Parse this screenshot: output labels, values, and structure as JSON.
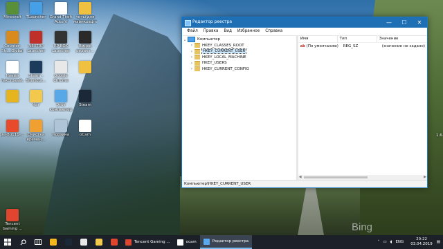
{
  "desktop": {
    "icons_col1": [
      {
        "label": "Minecraft",
        "color": "#5a8f3a"
      },
      {
        "label": "Counter-Str... Global Offe...",
        "color": "#d88a1c"
      },
      {
        "label": "Новый текстовый...",
        "color": "#ffffff"
      },
      {
        "label": "",
        "color": "#e6b41e"
      },
      {
        "label": "jre-8u111-...",
        "color": "#e84b2c"
      },
      {
        "label": "Tencent Gaming ...",
        "color": "#e0462f"
      }
    ],
    "icons_col2": [
      {
        "label": "TLauncher",
        "color": "#46a0e8"
      },
      {
        "label": "NEXTRP Launcher",
        "color": "#c0302a"
      },
      {
        "label": "Steam - Shortcut...",
        "color": "#1d3b5a"
      },
      {
        "label": "Чат",
        "color": "#f2c94c"
      },
      {
        "label": "Очистка времен...",
        "color": "#f0a030"
      }
    ],
    "icons_col3": [
      {
        "label": "Grand Theft Auto V",
        "color": "#ffffff"
      },
      {
        "label": "RP BOX Launcher",
        "color": "#333333"
      },
      {
        "label": "Google Chrome",
        "color": "#e8e8e8"
      },
      {
        "label": "Этот компьютер",
        "color": "#58a8e8"
      },
      {
        "label": "Корзина",
        "color": "#b0c4d8"
      }
    ],
    "icons_col4": [
      {
        "label": "читы для майнкрафта",
        "color": "#f0c040"
      },
      {
        "label": "Видео редакт...",
        "color": "#2a2a2a"
      },
      {
        "label": "",
        "color": "#f0c040"
      },
      {
        "label": "Steam",
        "color": "#1b2838"
      },
      {
        "label": "oCam",
        "color": "#ffffff"
      }
    ],
    "edge_fragment": "1.6.8",
    "bing_logo": "Bing"
  },
  "window": {
    "title": "Редактор реестра",
    "controls": {
      "minimize": "—",
      "maximize": "☐",
      "close": "✕"
    },
    "menu": [
      "Файл",
      "Правка",
      "Вид",
      "Избранное",
      "Справка"
    ],
    "tree": {
      "root": "Компьютер",
      "keys": [
        "HKEY_CLASSES_ROOT",
        "HKEY_CURRENT_USER",
        "HKEY_LOCAL_MACHINE",
        "HKEY_USERS",
        "HKEY_CURRENT_CONFIG"
      ],
      "selected_index": 1
    },
    "values": {
      "columns": [
        "Имя",
        "Тип",
        "Значение"
      ],
      "rows": [
        {
          "name": "(По умолчанию)",
          "type": "REG_SZ",
          "value": "(значение не задано)"
        }
      ],
      "row_icon": "ab"
    },
    "status_path": "Компьютер\\HKEY_CURRENT_USER"
  },
  "taskbar": {
    "apps": [
      {
        "label": "Tencent Gaming ...",
        "color": "#e0462f",
        "active": false
      },
      {
        "label": "ocam",
        "color": "#ffffff",
        "active": false
      },
      {
        "label": "Редактор реестра",
        "color": "#5aa8ef",
        "active": true
      }
    ],
    "pinned_colors": [
      "#f2b81e",
      "#1b2838",
      "#e8e8e8",
      "#f2c94c",
      "#e0462f"
    ],
    "language": "ENG",
    "time": "20:22",
    "date": "03.04.2019"
  }
}
